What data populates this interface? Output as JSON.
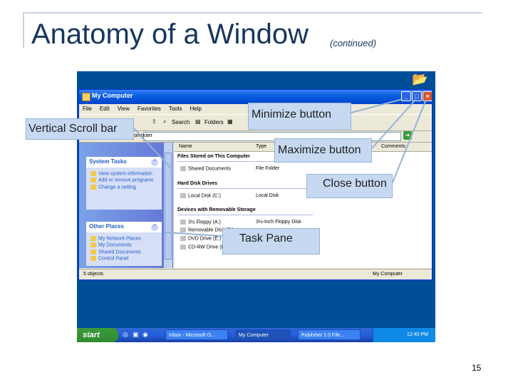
{
  "slide": {
    "title": "Anatomy of a Window",
    "subtitle": "(continued)",
    "page_number": "15"
  },
  "window": {
    "title": "My Computer",
    "menu": [
      "File",
      "Edit",
      "View",
      "Favorites",
      "Tools",
      "Help"
    ],
    "toolbar": {
      "search": "Search",
      "folders": "Folders"
    },
    "address_value": "My Computer",
    "columns": [
      "Name",
      "Type",
      "Comments"
    ],
    "groups": {
      "stored": "Files Stored on This Computer",
      "hdd": "Hard Disk Drives",
      "removable": "Devices with Removable Storage"
    },
    "rows": {
      "shared_docs": {
        "name": "Shared Documents",
        "type": "File Folder"
      },
      "local_disk": {
        "name": "Local Disk (C:)",
        "type": "Local Disk"
      },
      "floppy": {
        "name": "3½ Floppy (A:)",
        "type": "3½-Inch Floppy Disk"
      },
      "removable": {
        "name": "Removable Disk (F:)"
      },
      "dvd": {
        "name": "DVD Drive (E:)"
      },
      "cdrw": {
        "name": "CD-RW Drive (F:)"
      }
    },
    "task_pane": {
      "system_tasks": {
        "heading": "System Tasks",
        "items": [
          "View system information",
          "Add or remove programs",
          "Change a setting"
        ]
      },
      "other_places": {
        "heading": "Other Places",
        "items": [
          "My Network Places",
          "My Documents",
          "Shared Documents",
          "Control Panel"
        ]
      }
    },
    "status": {
      "left": "5 objects",
      "right": "My Computer"
    }
  },
  "taskbar": {
    "start": "start",
    "tasks": [
      "Inbox - Microsoft O...",
      "My Computer",
      "Publisher 2.0 File..."
    ],
    "clock": "12:40 PM"
  },
  "callouts": {
    "vertical_scroll": "Vertical Scroll bar",
    "minimize": "Minimize button",
    "maximize": "Maximize button",
    "close": "Close button",
    "task_pane": "Task Pane"
  }
}
